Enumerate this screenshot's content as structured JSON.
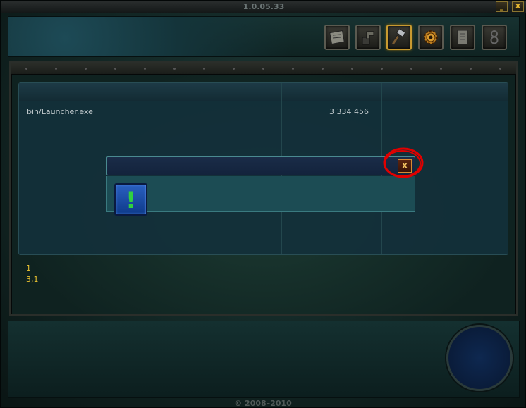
{
  "window": {
    "version": "1.0.05.33",
    "minimize_label": "_",
    "close_label": "X",
    "copyright": "© 2008–2010"
  },
  "toolbar": {
    "buttons": [
      {
        "icon": "news-icon"
      },
      {
        "icon": "wrench-icon"
      },
      {
        "icon": "hammer-icon",
        "active": true
      },
      {
        "icon": "gear-icon"
      },
      {
        "icon": "log-icon"
      },
      {
        "icon": "info-icon"
      }
    ]
  },
  "file_list": {
    "rows": [
      {
        "name": "bin/Launcher.exe",
        "size": "3 334 456"
      }
    ]
  },
  "dialog": {
    "close_label": "X",
    "icon": "warning-icon",
    "icon_glyph": "!"
  },
  "status": {
    "line1": "1",
    "line2": "3,1"
  },
  "colors": {
    "accent_gold": "#e8c030",
    "highlight_ring": "#e00000",
    "warning_green": "#30d040"
  }
}
